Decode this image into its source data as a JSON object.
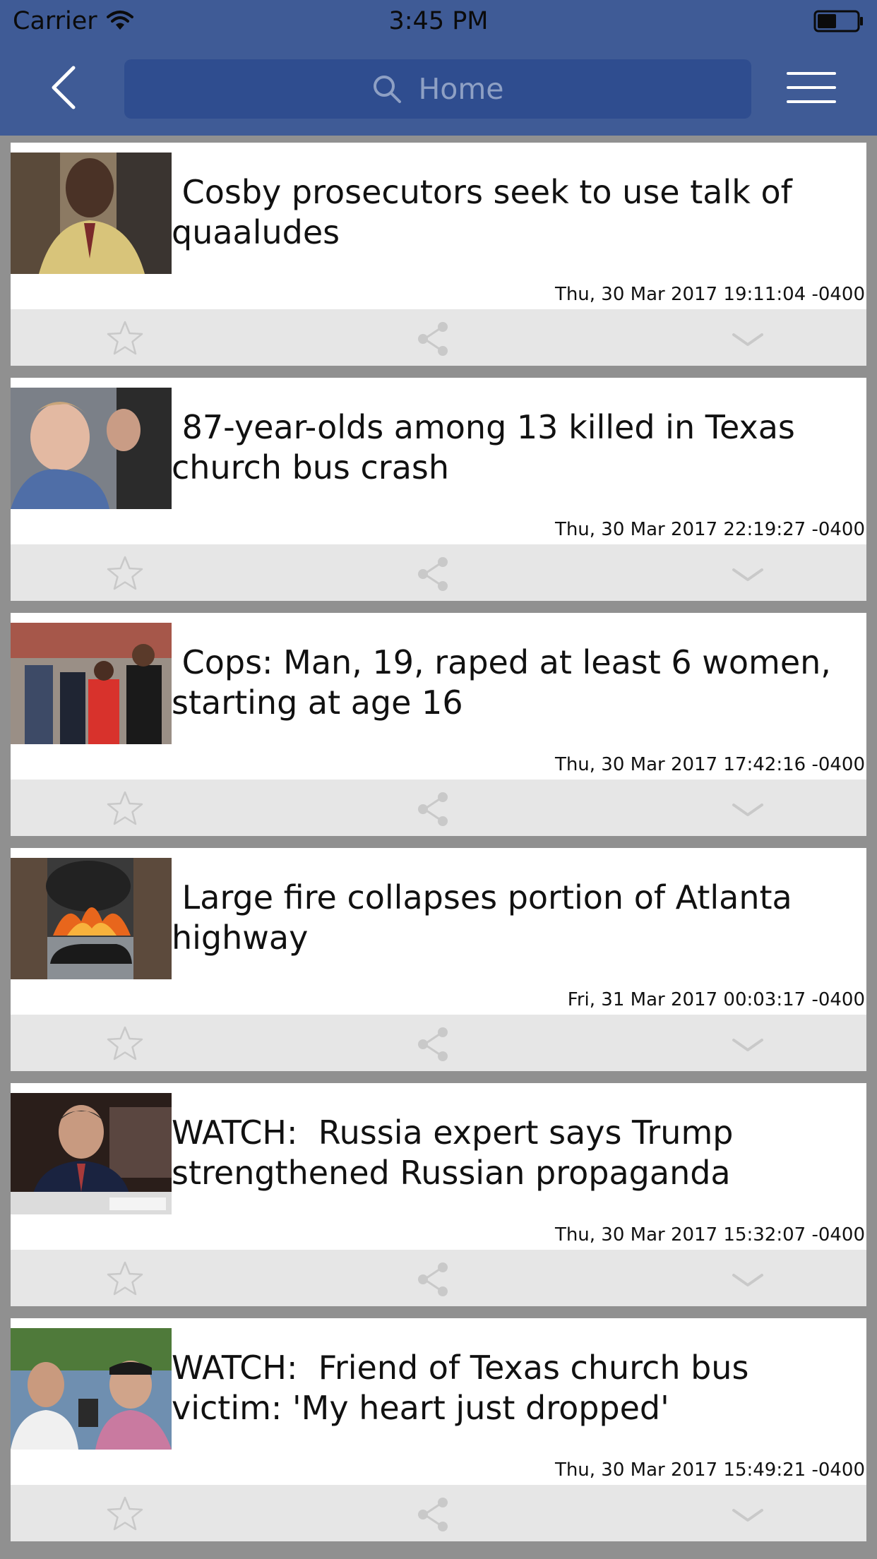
{
  "status_bar": {
    "carrier": "Carrier",
    "time": "3:45 PM"
  },
  "navbar": {
    "search_placeholder": "Home"
  },
  "colors": {
    "nav_background": "#3f5b96",
    "search_background": "#2f4d8f",
    "action_bar": "#e6e6e6",
    "action_icon": "#c9c9c9"
  },
  "icons": {
    "back": "chevron-left-icon",
    "search": "search-icon",
    "menu": "hamburger-menu-icon",
    "favorite": "star-icon",
    "share": "share-icon",
    "expand": "chevron-down-icon"
  },
  "articles": [
    {
      "title": " Cosby prosecutors seek to use talk of\nquaaludes",
      "timestamp": "Thu, 30 Mar 2017 19:11:04 -0400"
    },
    {
      "title": " 87-year-olds among 13 killed in Texas\nchurch bus crash",
      "timestamp": "Thu, 30 Mar 2017 22:19:27 -0400"
    },
    {
      "title": " Cops: Man, 19, raped at least 6 women,\nstarting at age 16",
      "timestamp": "Thu, 30 Mar 2017 17:42:16 -0400"
    },
    {
      "title": " Large fire collapses portion of Atlanta\nhighway",
      "timestamp": "Fri, 31 Mar 2017 00:03:17 -0400"
    },
    {
      "title": "WATCH:  Russia expert says Trump\nstrengthened Russian propaganda",
      "timestamp": "Thu, 30 Mar 2017 15:32:07 -0400"
    },
    {
      "title": "WATCH:  Friend of Texas church bus\nvictim: 'My heart just dropped'",
      "timestamp": "Thu, 30 Mar 2017 15:49:21 -0400"
    }
  ]
}
